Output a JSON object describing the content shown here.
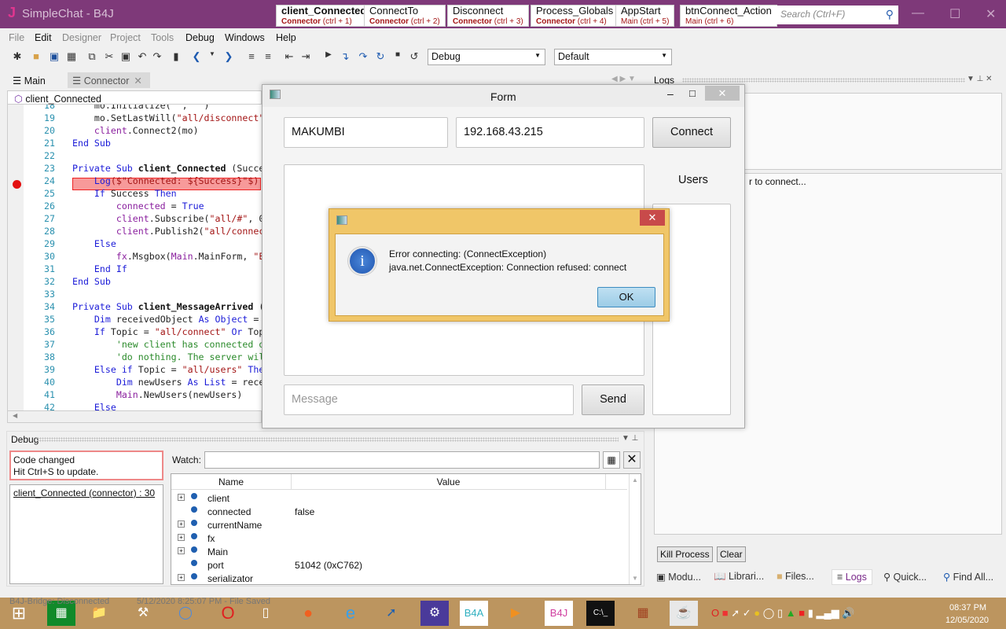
{
  "app": {
    "logo": "J",
    "title": "SimpleChat - B4J"
  },
  "quick_tabs": [
    {
      "title": "client_Connected",
      "module": "Connector",
      "shortcut": "(ctrl + 1)"
    },
    {
      "title": "ConnectTo",
      "module": "Connector",
      "shortcut": "(ctrl + 2)"
    },
    {
      "title": "Disconnect",
      "module": "Connector",
      "shortcut": "(ctrl + 3)"
    },
    {
      "title": "Process_Globals",
      "module": "Connector",
      "shortcut": "(ctrl + 4)"
    },
    {
      "title": "AppStart",
      "module": "Main",
      "shortcut": "(ctrl + 5)"
    },
    {
      "title": "btnConnect_Action",
      "module": "Main",
      "shortcut": "(ctrl + 6)"
    }
  ],
  "search": {
    "placeholder": "Search (Ctrl+F)"
  },
  "menu": [
    "File",
    "Edit",
    "Designer",
    "Project",
    "Tools",
    "Debug",
    "Windows",
    "Help"
  ],
  "toolbar": {
    "icons": [
      "new-icon",
      "open-icon",
      "save-icon",
      "save-all-icon",
      "copy-icon",
      "cut-icon",
      "paste-icon",
      "undo-icon",
      "redo-icon",
      "bookmark-icon",
      "back-icon",
      "forward-icon",
      "comment-icon",
      "uncomment-icon",
      "outdent-icon",
      "indent-icon",
      "run-icon",
      "step-in-icon",
      "step-over-icon",
      "step-out-icon",
      "stop-icon",
      "restart-icon"
    ],
    "build_config": "Debug",
    "form_config": "Default"
  },
  "editor": {
    "tabs": [
      {
        "label": "Main"
      },
      {
        "label": "Connector"
      }
    ],
    "current_sub": "client_Connected",
    "lines": [
      {
        "n": "18",
        "t": [
          [
            "    mo.Initialize(\"\", \"\")",
            ""
          ]
        ]
      },
      {
        "n": "19",
        "t": [
          [
            "    mo.SetLastWill(",
            ""
          ],
          [
            "\"all/disconnect\"",
            "s"
          ]
        ]
      },
      {
        "n": "20",
        "t": [
          [
            "    ",
            ""
          ],
          [
            "client",
            "v"
          ],
          [
            ".Connect2(mo)",
            ""
          ]
        ]
      },
      {
        "n": "21",
        "t": [
          [
            "End Sub",
            "k"
          ]
        ]
      },
      {
        "n": "22",
        "t": []
      },
      {
        "n": "23",
        "t": [
          [
            "Private Sub ",
            "k"
          ],
          [
            "client_Connected",
            "b"
          ],
          [
            " (Succe",
            ""
          ]
        ]
      },
      {
        "n": "24",
        "t": [
          [
            "    ",
            ""
          ],
          [
            "Log",
            "k"
          ],
          [
            "($\"Connected: ${Success}\"$)",
            "s"
          ]
        ]
      },
      {
        "n": "25",
        "t": [
          [
            "    ",
            ""
          ],
          [
            "If",
            "k"
          ],
          [
            " Success ",
            ""
          ],
          [
            "Then",
            "k"
          ]
        ]
      },
      {
        "n": "26",
        "t": [
          [
            "        ",
            ""
          ],
          [
            "connected",
            "v"
          ],
          [
            " = ",
            ""
          ],
          [
            "True",
            "k"
          ]
        ]
      },
      {
        "n": "27",
        "t": [
          [
            "        ",
            ""
          ],
          [
            "client",
            "v"
          ],
          [
            ".Subscribe(",
            ""
          ],
          [
            "\"all/#\"",
            "s"
          ],
          [
            ", 0",
            ""
          ]
        ]
      },
      {
        "n": "28",
        "t": [
          [
            "        ",
            ""
          ],
          [
            "client",
            "v"
          ],
          [
            ".Publish2(",
            ""
          ],
          [
            "\"all/connec",
            "s"
          ]
        ]
      },
      {
        "n": "29",
        "t": [
          [
            "    ",
            ""
          ],
          [
            "Else",
            "k"
          ]
        ]
      },
      {
        "n": "30",
        "t": [
          [
            "        ",
            ""
          ],
          [
            "fx",
            "v"
          ],
          [
            ".Msgbox(",
            ""
          ],
          [
            "Main",
            "v"
          ],
          [
            ".MainForm, ",
            ""
          ],
          [
            "\"E",
            "s"
          ]
        ]
      },
      {
        "n": "31",
        "t": [
          [
            "    ",
            ""
          ],
          [
            "End If",
            "k"
          ]
        ]
      },
      {
        "n": "32",
        "t": [
          [
            "End Sub",
            "k"
          ]
        ]
      },
      {
        "n": "33",
        "t": []
      },
      {
        "n": "34",
        "t": [
          [
            "Private Sub ",
            "k"
          ],
          [
            "client_MessageArrived",
            "b"
          ],
          [
            " (",
            ""
          ]
        ]
      },
      {
        "n": "35",
        "t": [
          [
            "    ",
            ""
          ],
          [
            "Dim",
            "k"
          ],
          [
            " receivedObject ",
            ""
          ],
          [
            "As",
            "k"
          ],
          [
            " ",
            ""
          ],
          [
            "Object",
            "k"
          ],
          [
            " =",
            ""
          ]
        ]
      },
      {
        "n": "36",
        "t": [
          [
            "    ",
            ""
          ],
          [
            "If",
            "k"
          ],
          [
            " Topic = ",
            ""
          ],
          [
            "\"all/connect\"",
            "s"
          ],
          [
            " ",
            ""
          ],
          [
            "Or",
            "k"
          ],
          [
            " Top",
            ""
          ]
        ]
      },
      {
        "n": "37",
        "t": [
          [
            "        ",
            ""
          ],
          [
            "'new client has connected o",
            "c"
          ]
        ]
      },
      {
        "n": "38",
        "t": [
          [
            "        ",
            ""
          ],
          [
            "'do nothing. The server wil",
            "c"
          ]
        ]
      },
      {
        "n": "39",
        "t": [
          [
            "    ",
            ""
          ],
          [
            "Else if",
            "k"
          ],
          [
            " Topic = ",
            ""
          ],
          [
            "\"all/users\"",
            "s"
          ],
          [
            " ",
            ""
          ],
          [
            "The",
            "k"
          ]
        ]
      },
      {
        "n": "40",
        "t": [
          [
            "        ",
            ""
          ],
          [
            "Dim",
            "k"
          ],
          [
            " newUsers ",
            ""
          ],
          [
            "As",
            "k"
          ],
          [
            " ",
            ""
          ],
          [
            "List",
            "k"
          ],
          [
            " = rece",
            ""
          ]
        ]
      },
      {
        "n": "41",
        "t": [
          [
            "        ",
            ""
          ],
          [
            "Main",
            "v"
          ],
          [
            ".NewUsers(newUsers)",
            ""
          ]
        ]
      },
      {
        "n": "42",
        "t": [
          [
            "    ",
            ""
          ],
          [
            "Else",
            "k"
          ]
        ]
      }
    ]
  },
  "debug": {
    "title": "Debug",
    "code_changed": "Code changed",
    "hint": "Hit Ctrl+S to update.",
    "stack_frame": "client_Connected (connector) : 30",
    "watch_label": "Watch:",
    "columns": [
      "Name",
      "Value"
    ],
    "vars": [
      {
        "name": "client",
        "value": "",
        "expandable": true
      },
      {
        "name": "connected",
        "value": "false",
        "expandable": false
      },
      {
        "name": "currentName",
        "value": "",
        "expandable": true
      },
      {
        "name": "fx",
        "value": "",
        "expandable": true
      },
      {
        "name": "Main",
        "value": "",
        "expandable": true
      },
      {
        "name": "port",
        "value": "51042 (0xC762)",
        "expandable": false
      },
      {
        "name": "serializator",
        "value": "",
        "expandable": true
      }
    ]
  },
  "logs": {
    "title": "Logs",
    "log_text": "r to connect...",
    "kill_label": "Kill Process",
    "clear_label": "Clear",
    "bottom_tabs": [
      "Modu...",
      "Librari...",
      "Files...",
      "Logs",
      "Quick...",
      "Find All..."
    ],
    "active_tab": "Logs"
  },
  "form": {
    "title": "Form",
    "name_value": "MAKUMBI",
    "ip_value": "192.168.43.215",
    "connect_label": "Connect",
    "users_label": "Users",
    "message_placeholder": "Message",
    "send_label": "Send"
  },
  "dialog": {
    "line1": "Error connecting: (ConnectException)",
    "line2": "java.net.ConnectException: Connection refused: connect",
    "ok_label": "OK"
  },
  "status": {
    "bridge": "B4J-Bridge: Disconnected",
    "saved": "5/12/2020 8:25:07 PM - File Saved"
  },
  "taskbar": {
    "apps": [
      "windows-start",
      "store",
      "file-explorer",
      "tools",
      "chrome",
      "opera",
      "file",
      "firefox",
      "internet-explorer",
      "safari-like",
      "settings",
      "B4A",
      "media-player",
      "B4J",
      "command-prompt",
      "firewall",
      "java"
    ],
    "b4a_label": "B4A",
    "b4j_label": "B4J",
    "cmd_label": "C:\\_",
    "time": "08:37 PM",
    "date": "12/05/2020"
  },
  "colors": {
    "titlebar": "#7e3979",
    "breakpoint": "#e31010",
    "dialog_border": "#f0c668",
    "taskbar": "#b88e54"
  }
}
